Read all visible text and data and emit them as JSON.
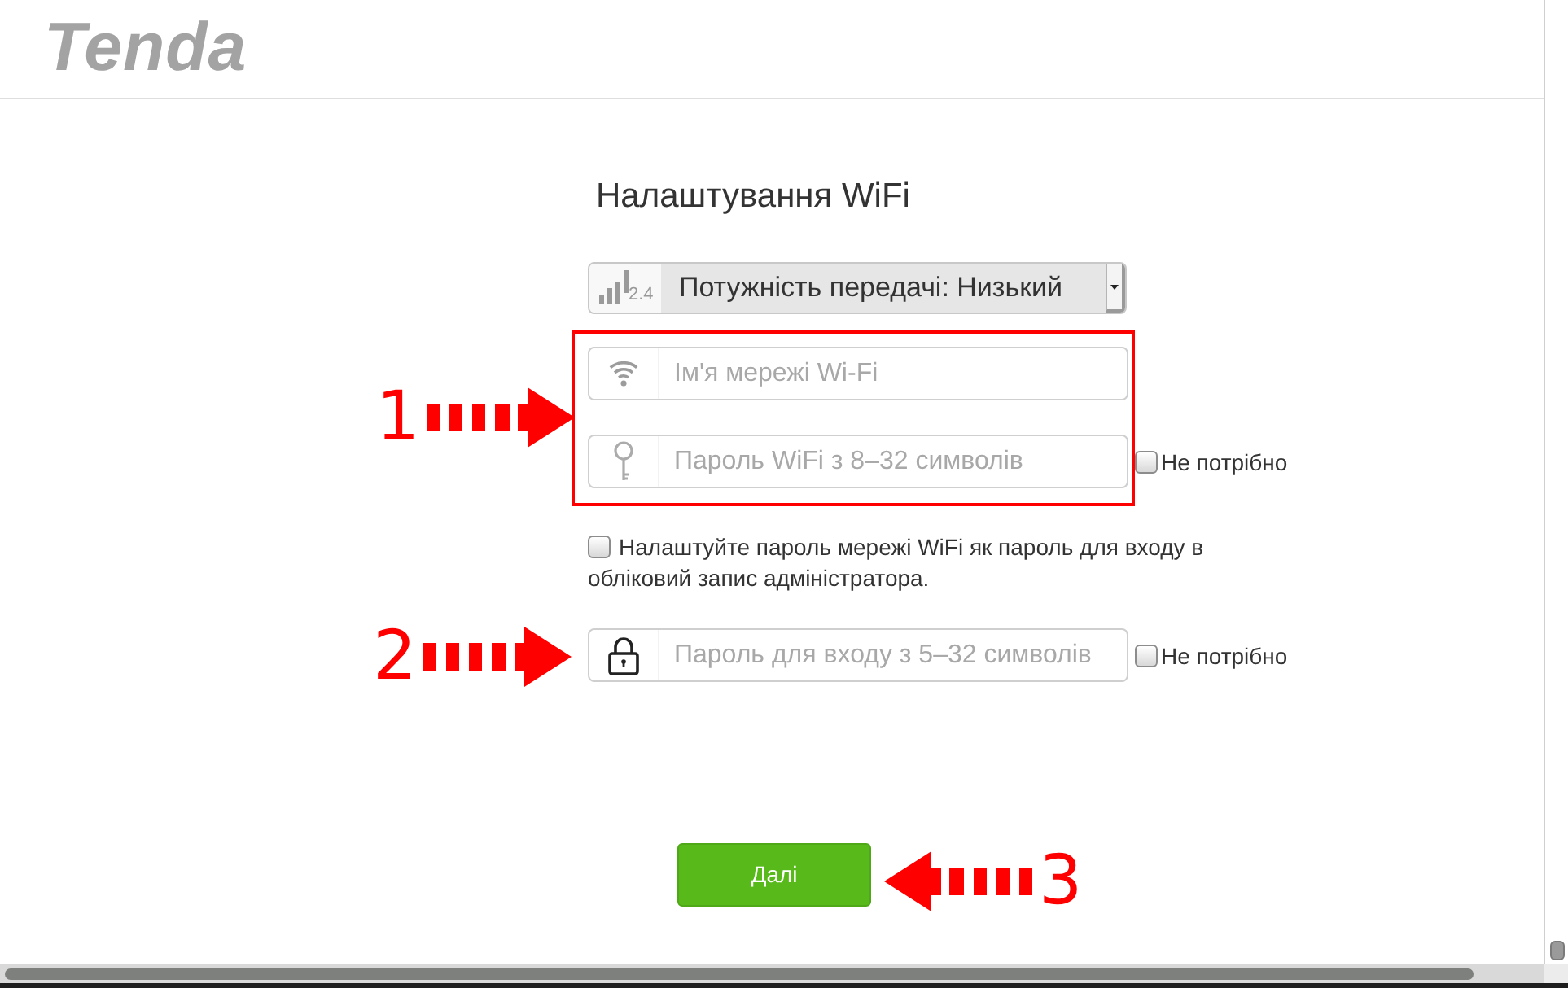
{
  "header": {
    "logo": "Tenda"
  },
  "title": "Налаштування WiFi",
  "power_select": {
    "band": "2.4",
    "value": "Потужність передачі: Низький"
  },
  "wifi_fields": [
    {
      "kind": "wifi_name",
      "placeholder": "Ім'я мережі Wi-Fi"
    },
    {
      "kind": "wifi_password",
      "placeholder": "Пароль WiFi з 8–32 символів",
      "not_needed": {
        "label": "Не потрібно",
        "checked": false
      }
    }
  ],
  "admin_same_password": {
    "label": "Налаштуйте пароль мережі WiFi як пароль для входу в обліковий запис адміністратора.",
    "checked": false
  },
  "login_field": {
    "kind": "login_password",
    "placeholder": "Пароль для входу з 5–32 символів",
    "not_needed": {
      "label": "Не потрібно",
      "checked": false
    }
  },
  "next_button": {
    "label": "Далі"
  },
  "annotations": [
    {
      "number": "1",
      "kind": "right_arrow"
    },
    {
      "number": "2",
      "kind": "right_arrow"
    },
    {
      "number": "3",
      "kind": "left_arrow"
    }
  ]
}
